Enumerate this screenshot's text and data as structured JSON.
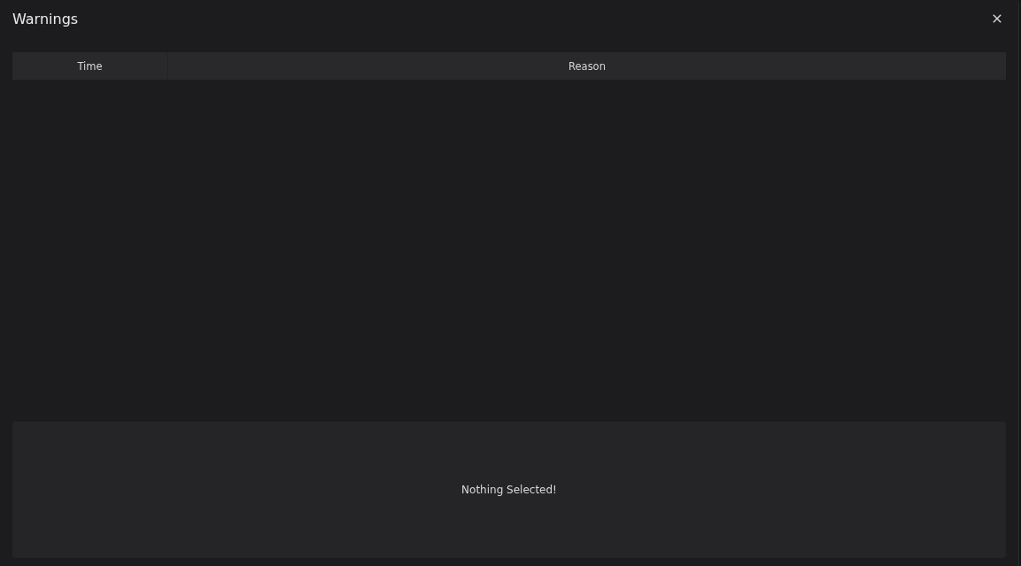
{
  "window": {
    "title": "Warnings"
  },
  "table": {
    "columns": [
      {
        "label": "Time"
      },
      {
        "label": "Reason"
      }
    ]
  },
  "details": {
    "message": "Nothing Selected!"
  }
}
